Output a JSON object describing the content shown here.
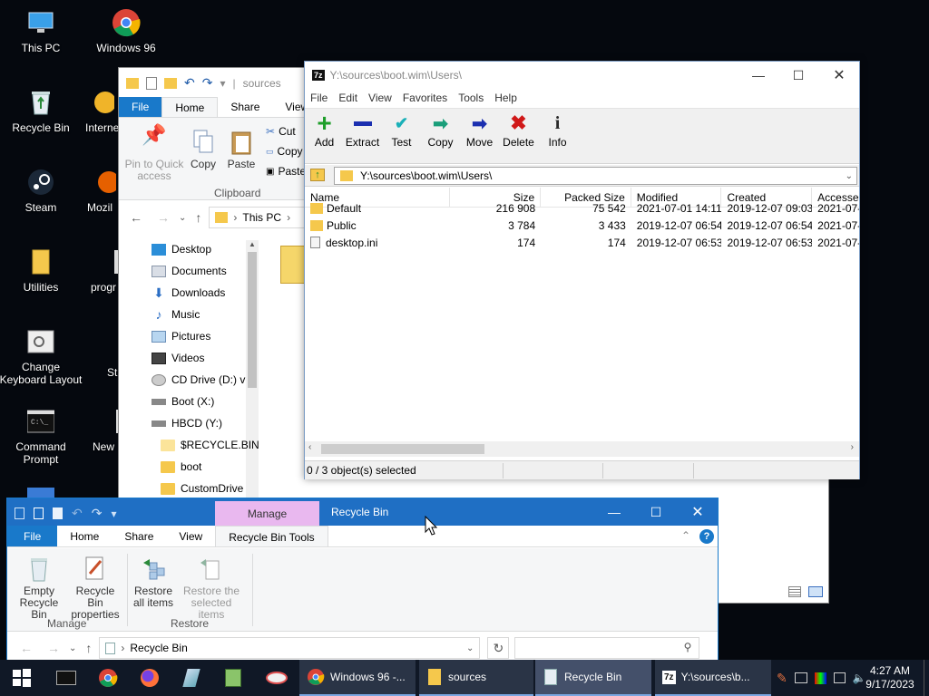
{
  "desktop": {
    "icons": [
      {
        "label": "This PC",
        "icon": "this-pc-icon"
      },
      {
        "label": "Windows 96",
        "icon": "chrome-icon"
      },
      {
        "label": "Recycle Bin",
        "icon": "recycle-bin-icon"
      },
      {
        "label": "Interne",
        "icon": "edge-icon"
      },
      {
        "label": "Steam",
        "icon": "steam-icon"
      },
      {
        "label": "Mozil",
        "icon": "firefox-icon"
      },
      {
        "label": "Utilities",
        "icon": "folder-icon"
      },
      {
        "label": "progr",
        "icon": "folder-icon"
      },
      {
        "label": "Change Keyboard Layout",
        "icon": "keyboard-settings-icon"
      },
      {
        "label": "St",
        "icon": "app-icon"
      },
      {
        "label": "Command Prompt",
        "icon": "cmd-icon"
      },
      {
        "label": "New",
        "icon": "doc-icon"
      }
    ]
  },
  "explorer": {
    "path_title": "sources",
    "tabs": [
      "File",
      "Home",
      "Share",
      "View"
    ],
    "clipboard": {
      "pin_label": "Pin to Quick access",
      "copy_label": "Copy",
      "paste_label": "Paste",
      "cut_label": "Cut",
      "copy_path_label": "Copy",
      "paste_shortcut_label": "Paste",
      "group_label": "Clipboard"
    },
    "breadcrumb": "This PC",
    "tree": [
      {
        "label": "Desktop",
        "icon": "desktop-icon"
      },
      {
        "label": "Documents",
        "icon": "documents-icon"
      },
      {
        "label": "Downloads",
        "icon": "downloads-icon"
      },
      {
        "label": "Music",
        "icon": "music-icon"
      },
      {
        "label": "Pictures",
        "icon": "pictures-icon"
      },
      {
        "label": "Videos",
        "icon": "videos-icon"
      },
      {
        "label": "CD Drive (D:) v",
        "icon": "cd-drive-icon"
      },
      {
        "label": "Boot (X:)",
        "icon": "drive-icon"
      },
      {
        "label": "HBCD (Y:)",
        "icon": "drive-icon"
      },
      {
        "label": "$RECYCLE.BIN",
        "icon": "folder-icon"
      },
      {
        "label": "boot",
        "icon": "folder-icon"
      },
      {
        "label": "CustomDrive",
        "icon": "folder-icon"
      }
    ]
  },
  "sevenzip": {
    "title": "Y:\\sources\\boot.wim\\Users\\",
    "menu": [
      "File",
      "Edit",
      "View",
      "Favorites",
      "Tools",
      "Help"
    ],
    "toolbar": [
      {
        "label": "Add",
        "icon": "add-icon",
        "color": "#1e9e2a"
      },
      {
        "label": "Extract",
        "icon": "extract-icon",
        "color": "#1b2fb0"
      },
      {
        "label": "Test",
        "icon": "test-icon",
        "color": "#19b0b8"
      },
      {
        "label": "Copy",
        "icon": "copy-icon",
        "color": "#1a9e7a"
      },
      {
        "label": "Move",
        "icon": "move-icon",
        "color": "#1b2fb0"
      },
      {
        "label": "Delete",
        "icon": "delete-icon",
        "color": "#d01818"
      },
      {
        "label": "Info",
        "icon": "info-icon",
        "color": "#2a2a2a"
      }
    ],
    "path": "Y:\\sources\\boot.wim\\Users\\",
    "columns": [
      "Name",
      "Size",
      "Packed Size",
      "Modified",
      "Created",
      "Accesse"
    ],
    "rows": [
      {
        "name": "Default",
        "size": "216 908",
        "packed": "75 542",
        "modified": "2021-07-01 14:11",
        "created": "2019-12-07 09:03",
        "accessed": "2021-07-",
        "type": "folder"
      },
      {
        "name": "Public",
        "size": "3 784",
        "packed": "3 433",
        "modified": "2019-12-07 06:54",
        "created": "2019-12-07 06:54",
        "accessed": "2021-07-",
        "type": "folder"
      },
      {
        "name": "desktop.ini",
        "size": "174",
        "packed": "174",
        "modified": "2019-12-07 06:53",
        "created": "2019-12-07 06:53",
        "accessed": "2021-07-",
        "type": "file"
      }
    ],
    "status": "0 / 3 object(s) selected"
  },
  "recyclebin": {
    "manage_tab": "Manage",
    "title": "Recycle Bin",
    "tabs": [
      "File",
      "Home",
      "Share",
      "View"
    ],
    "context_tab": "Recycle Bin Tools",
    "empty_label": "Empty Recycle Bin",
    "properties_label": "Recycle Bin properties",
    "manage_group": "Manage",
    "restore_all_label": "Restore all items",
    "restore_selected_label": "Restore the selected items",
    "restore_group": "Restore",
    "address": "Recycle Bin"
  },
  "taskbar": {
    "apps": [
      {
        "label": "Windows 96 -...",
        "icon": "chrome-icon"
      },
      {
        "label": "sources",
        "icon": "folder-icon"
      },
      {
        "label": "Recycle Bin",
        "icon": "recycle-bin-icon"
      },
      {
        "label": "Y:\\sources\\b...",
        "icon": "7zip-icon"
      }
    ],
    "time": "4:27 AM",
    "date": "9/17/2023"
  }
}
